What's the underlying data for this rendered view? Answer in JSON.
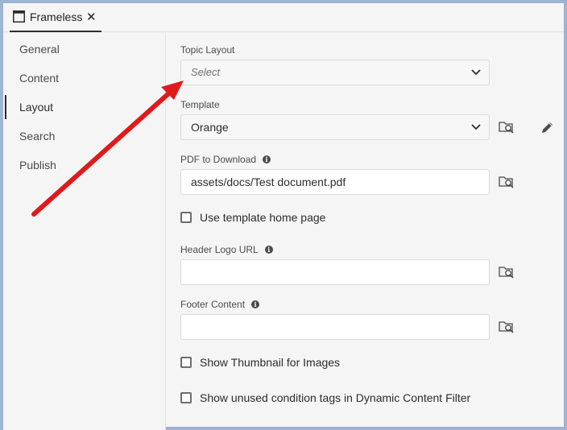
{
  "tab": {
    "label": "Frameless"
  },
  "sidebar": {
    "items": [
      {
        "label": "General"
      },
      {
        "label": "Content"
      },
      {
        "label": "Layout"
      },
      {
        "label": "Search"
      },
      {
        "label": "Publish"
      }
    ],
    "active": "Layout"
  },
  "form": {
    "topic_layout": {
      "label": "Topic Layout",
      "placeholder": "Select"
    },
    "template": {
      "label": "Template",
      "value": "Orange"
    },
    "pdf": {
      "label": "PDF to Download",
      "value": "assets/docs/Test document.pdf"
    },
    "use_template_home": {
      "label": "Use template home page",
      "checked": false
    },
    "header_logo": {
      "label": "Header Logo URL",
      "value": ""
    },
    "footer_content": {
      "label": "Footer Content",
      "value": ""
    },
    "show_thumbnail": {
      "label": "Show Thumbnail for Images",
      "checked": false
    },
    "show_unused_tags": {
      "label": "Show unused condition tags in Dynamic Content Filter",
      "checked": false
    }
  },
  "colors": {
    "annotation_arrow": "#e0191b",
    "frame_border": "#9fb4d3"
  },
  "icons": [
    "window-icon",
    "close-icon",
    "chevron-down-icon",
    "folder-search-icon",
    "pencil-icon",
    "info-icon"
  ]
}
